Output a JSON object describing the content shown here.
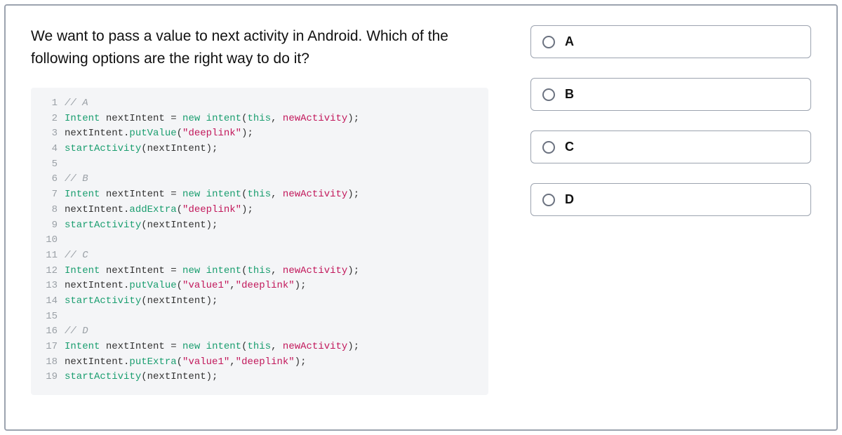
{
  "question": "We want to pass a value to next activity in Android. Which of the following options are the right way to do it?",
  "code_lines": [
    {
      "n": "1",
      "tokens": [
        {
          "c": "tok-comment",
          "t": "// A"
        }
      ]
    },
    {
      "n": "2",
      "tokens": [
        {
          "c": "tok-type",
          "t": "Intent"
        },
        {
          "c": "tok-plain",
          "t": " nextIntent = "
        },
        {
          "c": "tok-kw",
          "t": "new"
        },
        {
          "c": "tok-plain",
          "t": " "
        },
        {
          "c": "tok-method",
          "t": "intent"
        },
        {
          "c": "tok-plain",
          "t": "("
        },
        {
          "c": "tok-kw",
          "t": "this"
        },
        {
          "c": "tok-plain",
          "t": ", "
        },
        {
          "c": "tok-ident",
          "t": "newActivity"
        },
        {
          "c": "tok-plain",
          "t": ");"
        }
      ]
    },
    {
      "n": "3",
      "tokens": [
        {
          "c": "tok-plain",
          "t": "nextIntent."
        },
        {
          "c": "tok-method",
          "t": "putValue"
        },
        {
          "c": "tok-plain",
          "t": "("
        },
        {
          "c": "tok-str",
          "t": "\"deeplink\""
        },
        {
          "c": "tok-plain",
          "t": ");"
        }
      ]
    },
    {
      "n": "4",
      "tokens": [
        {
          "c": "tok-method",
          "t": "startActivity"
        },
        {
          "c": "tok-plain",
          "t": "(nextIntent);"
        }
      ]
    },
    {
      "n": "5",
      "tokens": [
        {
          "c": "tok-plain",
          "t": ""
        }
      ]
    },
    {
      "n": "6",
      "tokens": [
        {
          "c": "tok-comment",
          "t": "// B"
        }
      ]
    },
    {
      "n": "7",
      "tokens": [
        {
          "c": "tok-type",
          "t": "Intent"
        },
        {
          "c": "tok-plain",
          "t": " nextIntent = "
        },
        {
          "c": "tok-kw",
          "t": "new"
        },
        {
          "c": "tok-plain",
          "t": " "
        },
        {
          "c": "tok-method",
          "t": "intent"
        },
        {
          "c": "tok-plain",
          "t": "("
        },
        {
          "c": "tok-kw",
          "t": "this"
        },
        {
          "c": "tok-plain",
          "t": ", "
        },
        {
          "c": "tok-ident",
          "t": "newActivity"
        },
        {
          "c": "tok-plain",
          "t": ");"
        }
      ]
    },
    {
      "n": "8",
      "tokens": [
        {
          "c": "tok-plain",
          "t": "nextIntent."
        },
        {
          "c": "tok-method",
          "t": "addExtra"
        },
        {
          "c": "tok-plain",
          "t": "("
        },
        {
          "c": "tok-str",
          "t": "\"deeplink\""
        },
        {
          "c": "tok-plain",
          "t": ");"
        }
      ]
    },
    {
      "n": "9",
      "tokens": [
        {
          "c": "tok-method",
          "t": "startActivity"
        },
        {
          "c": "tok-plain",
          "t": "(nextIntent);"
        }
      ]
    },
    {
      "n": "10",
      "tokens": [
        {
          "c": "tok-plain",
          "t": ""
        }
      ]
    },
    {
      "n": "11",
      "tokens": [
        {
          "c": "tok-comment",
          "t": "// C"
        }
      ]
    },
    {
      "n": "12",
      "tokens": [
        {
          "c": "tok-type",
          "t": "Intent"
        },
        {
          "c": "tok-plain",
          "t": " nextIntent = "
        },
        {
          "c": "tok-kw",
          "t": "new"
        },
        {
          "c": "tok-plain",
          "t": " "
        },
        {
          "c": "tok-method",
          "t": "intent"
        },
        {
          "c": "tok-plain",
          "t": "("
        },
        {
          "c": "tok-kw",
          "t": "this"
        },
        {
          "c": "tok-plain",
          "t": ", "
        },
        {
          "c": "tok-ident",
          "t": "newActivity"
        },
        {
          "c": "tok-plain",
          "t": ");"
        }
      ]
    },
    {
      "n": "13",
      "tokens": [
        {
          "c": "tok-plain",
          "t": "nextIntent."
        },
        {
          "c": "tok-method",
          "t": "putValue"
        },
        {
          "c": "tok-plain",
          "t": "("
        },
        {
          "c": "tok-str",
          "t": "\"value1\""
        },
        {
          "c": "tok-plain",
          "t": ","
        },
        {
          "c": "tok-str",
          "t": "\"deeplink\""
        },
        {
          "c": "tok-plain",
          "t": ");"
        }
      ]
    },
    {
      "n": "14",
      "tokens": [
        {
          "c": "tok-method",
          "t": "startActivity"
        },
        {
          "c": "tok-plain",
          "t": "(nextIntent);"
        }
      ]
    },
    {
      "n": "15",
      "tokens": [
        {
          "c": "tok-plain",
          "t": ""
        }
      ]
    },
    {
      "n": "16",
      "tokens": [
        {
          "c": "tok-comment",
          "t": "// D"
        }
      ]
    },
    {
      "n": "17",
      "tokens": [
        {
          "c": "tok-type",
          "t": "Intent"
        },
        {
          "c": "tok-plain",
          "t": " nextIntent = "
        },
        {
          "c": "tok-kw",
          "t": "new"
        },
        {
          "c": "tok-plain",
          "t": " "
        },
        {
          "c": "tok-method",
          "t": "intent"
        },
        {
          "c": "tok-plain",
          "t": "("
        },
        {
          "c": "tok-kw",
          "t": "this"
        },
        {
          "c": "tok-plain",
          "t": ", "
        },
        {
          "c": "tok-ident",
          "t": "newActivity"
        },
        {
          "c": "tok-plain",
          "t": ");"
        }
      ]
    },
    {
      "n": "18",
      "tokens": [
        {
          "c": "tok-plain",
          "t": "nextIntent."
        },
        {
          "c": "tok-method",
          "t": "putExtra"
        },
        {
          "c": "tok-plain",
          "t": "("
        },
        {
          "c": "tok-str",
          "t": "\"value1\""
        },
        {
          "c": "tok-plain",
          "t": ","
        },
        {
          "c": "tok-str",
          "t": "\"deeplink\""
        },
        {
          "c": "tok-plain",
          "t": ");"
        }
      ]
    },
    {
      "n": "19",
      "tokens": [
        {
          "c": "tok-method",
          "t": "startActivity"
        },
        {
          "c": "tok-plain",
          "t": "(nextIntent);"
        }
      ]
    }
  ],
  "options": [
    {
      "label": "A"
    },
    {
      "label": "B"
    },
    {
      "label": "C"
    },
    {
      "label": "D"
    }
  ]
}
